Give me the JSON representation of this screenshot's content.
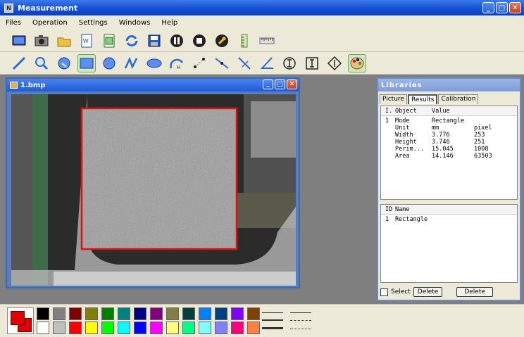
{
  "app": {
    "title": "Measurement",
    "menu": [
      "Files",
      "Operation",
      "Settings",
      "Windows",
      "Help"
    ]
  },
  "toolbar1": [
    "monitor-icon",
    "camera-icon",
    "open-folder-icon",
    "word-doc-icon",
    "excel-doc-icon",
    "refresh-icon",
    "save-icon",
    "pause-icon",
    "stop-icon",
    "wrench-icon",
    "vertical-ruler-icon",
    "horizontal-ruler-icon"
  ],
  "toolbar2": [
    "line-tool-icon",
    "magnifier-icon",
    "zoom-circle-icon",
    "rectangle-tool-icon",
    "circle-tool-icon",
    "polyline-tool-icon",
    "ellipse-tool-icon",
    "arc-tool-icon",
    "point-tool-icon",
    "point-line-tool-icon",
    "perpendicular-tool-icon",
    "angle-tool-icon",
    "circle-i-tool-icon",
    "i-beam-tool-icon",
    "diamond-tool-icon",
    "palette-tool-icon"
  ],
  "image_window": {
    "title": "1.bmp"
  },
  "libraries": {
    "title": "Libraries",
    "tabs": [
      "Picture",
      "Results",
      "Calibration"
    ],
    "active_tab": "Results",
    "results": {
      "headers": [
        "I.",
        "Object",
        "Value"
      ],
      "rows": [
        [
          "1",
          "Mode",
          "Rectangle",
          ""
        ],
        [
          "",
          "Unit",
          "mm",
          "pixel"
        ],
        [
          "",
          "Width",
          "3.776",
          "253"
        ],
        [
          "",
          "Height",
          "3.746",
          "251"
        ],
        [
          "",
          "Perim...",
          "15.045",
          "1008"
        ],
        [
          "",
          "Area",
          "14.146",
          "63503"
        ]
      ]
    },
    "objects": {
      "headers": [
        "ID",
        "Name"
      ],
      "rows": [
        [
          "1",
          "Rectangle"
        ]
      ]
    },
    "footer": {
      "select_label": "Select",
      "delete_label": "Delete",
      "delete_all_label": "Delete"
    }
  },
  "palette": {
    "current_fg": "#e00000",
    "current_bg": "#e00000",
    "row1": [
      "#000000",
      "#808080",
      "#800000",
      "#808000",
      "#008000",
      "#008080",
      "#000080",
      "#800080",
      "#808040",
      "#004040",
      "#0080ff",
      "#004080",
      "#8000ff",
      "#804000"
    ],
    "row2": [
      "#ffffff",
      "#c0c0c0",
      "#ff0000",
      "#ffff00",
      "#00ff00",
      "#00ffff",
      "#0000ff",
      "#ff00ff",
      "#ffff80",
      "#00ff80",
      "#80ffff",
      "#8080ff",
      "#ff0080",
      "#ff8040"
    ]
  }
}
